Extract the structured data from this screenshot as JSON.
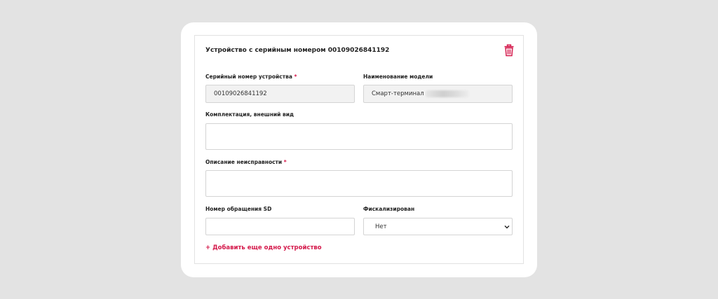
{
  "device": {
    "title": "Устройство с серийным номером 00109026841192",
    "delete_icon": "trash-icon"
  },
  "fields": {
    "serial": {
      "label": "Серийный номер устройства",
      "required_mark": "*",
      "value": "00109026841192"
    },
    "model": {
      "label": "Наименование модели",
      "value": "Смарт-терминал"
    },
    "kit": {
      "label": "Комплектация, внешний вид",
      "value": ""
    },
    "fault": {
      "label": "Описание неисправности",
      "required_mark": "*",
      "value": ""
    },
    "sd_number": {
      "label": "Номер обращения SD",
      "value": ""
    },
    "fiscal": {
      "label": "Фискализирован",
      "selected": "Нет",
      "chevron_icon": "chevron-down-icon"
    }
  },
  "actions": {
    "add_device": "+ Добавить еще одно устройство"
  },
  "colors": {
    "accent": "#d4184a",
    "background": "#e3e3e3",
    "card": "#ffffff",
    "disabled_field": "#f2f2f2"
  }
}
